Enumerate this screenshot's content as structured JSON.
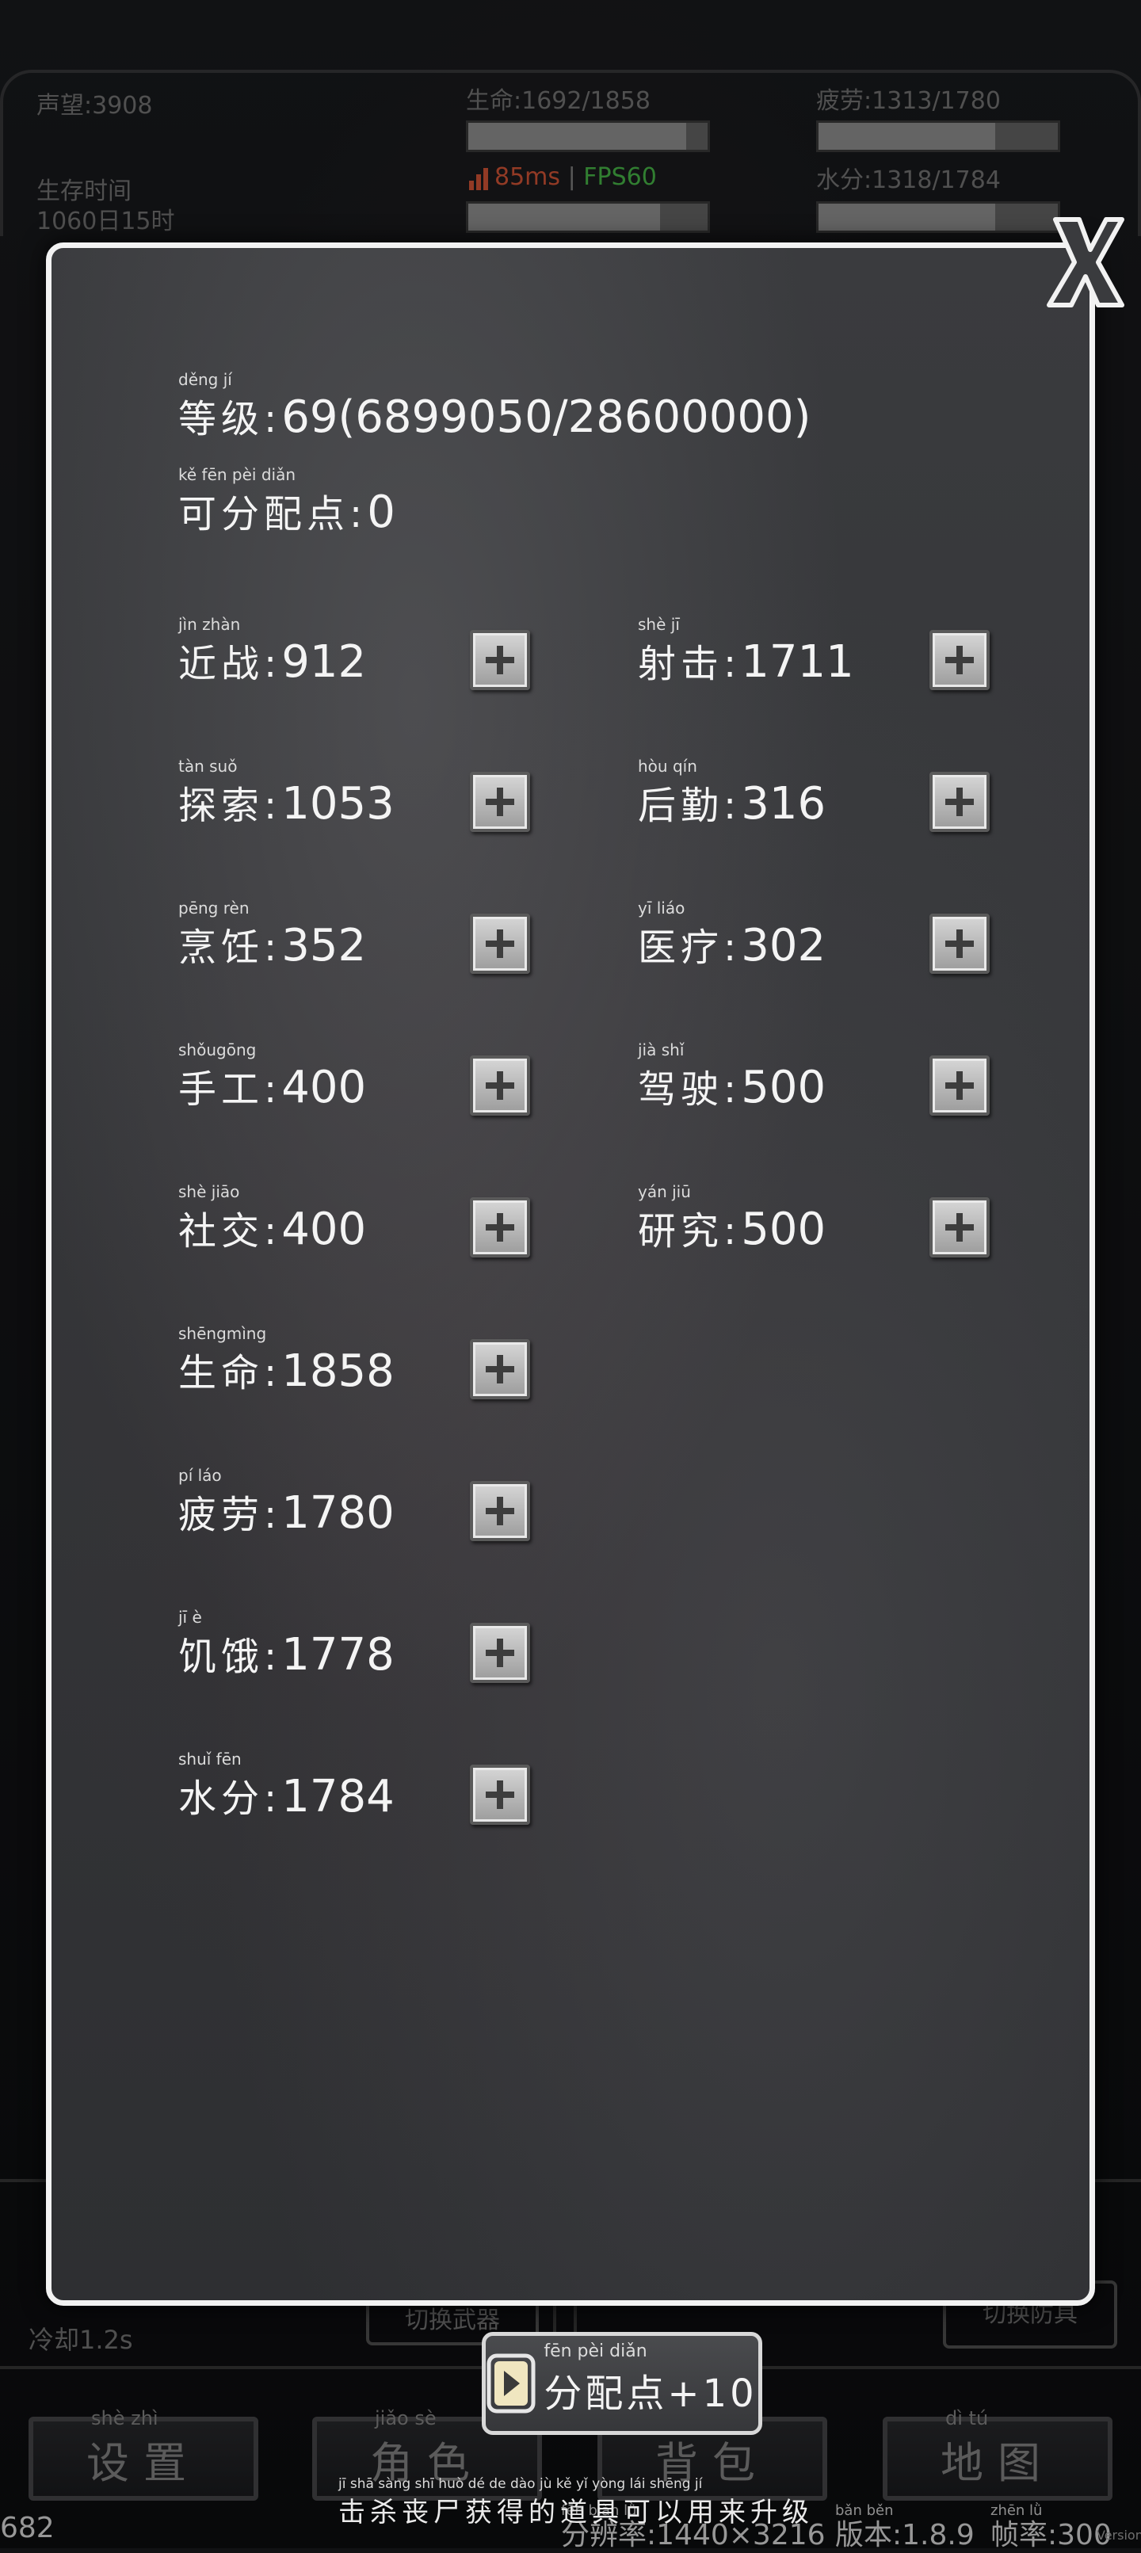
{
  "hud": {
    "reputation": "声望:3908",
    "survival_time_label": "生存时间",
    "survival_time_value": "1060日15时",
    "hp": "生命:1692/1858",
    "fatigue": "疲劳:1313/1780",
    "water": "水分:1318/1784",
    "ping": "85ms",
    "fps": "FPS60",
    "cooldown": "冷却1.2s",
    "switch_weapon": "切换武器",
    "switch_armor": "切换防具"
  },
  "modal": {
    "level_label": "等级:",
    "level_pinyin": "děng  jí",
    "level_value": "69(6899050/28600000)",
    "points_label": "可分配点:",
    "points_pinyin": "kě  fēn  pèi  diǎn",
    "points_value": "0",
    "stats_left": [
      {
        "label": "近战:",
        "pinyin": "jìn  zhàn",
        "value": "912"
      },
      {
        "label": "探索:",
        "pinyin": "tàn  suǒ",
        "value": "1053"
      },
      {
        "label": "烹饪:",
        "pinyin": "pēng  rèn",
        "value": "352"
      },
      {
        "label": "手工:",
        "pinyin": "shǒugōng",
        "value": "400"
      },
      {
        "label": "社交:",
        "pinyin": "shè  jiāo",
        "value": "400"
      },
      {
        "label": "生命:",
        "pinyin": "shēngmìng",
        "value": "1858"
      },
      {
        "label": "疲劳:",
        "pinyin": "pí  láo",
        "value": "1780"
      },
      {
        "label": "饥饿:",
        "pinyin": "jī  è",
        "value": "1778"
      },
      {
        "label": "水分:",
        "pinyin": "shuǐ  fēn",
        "value": "1784"
      }
    ],
    "stats_right": [
      {
        "label": "射击:",
        "pinyin": "shè  jī",
        "value": "1711"
      },
      {
        "label": "后勤:",
        "pinyin": "hòu  qín",
        "value": "316"
      },
      {
        "label": "医疗:",
        "pinyin": "yī  liáo",
        "value": "302"
      },
      {
        "label": "驾驶:",
        "pinyin": "jià  shǐ",
        "value": "500"
      },
      {
        "label": "研究:",
        "pinyin": "yán  jiū",
        "value": "500"
      }
    ],
    "ad_button_label": "分配点+10",
    "ad_button_pinyin": "fēn  pèi  diǎn",
    "tip": "击杀丧尸获得的道具可以用来升级",
    "tip_pinyin": "jī  shā sàng shī huò dé  de  dào  jù  kě  yǐ  yòng lái shēng jí"
  },
  "bottom_nav": [
    {
      "label": "设置",
      "pinyin": "shè  zhì"
    },
    {
      "label": "角色",
      "pinyin": "jiǎo  sè"
    },
    {
      "label": "背包",
      "pinyin": "bèi  bāo"
    },
    {
      "label": "地图",
      "pinyin": "dì  tú"
    }
  ],
  "footer": {
    "left": "682",
    "resolution": "分辨率:1440×3216",
    "resolution_pinyin": "fēn biàn  lǜ",
    "version": "版本:1.8.9",
    "version_pinyin": "bǎn běn",
    "framerate": "帧率:300",
    "framerate_pinyin": "zhēn  lǜ",
    "corner_tag": "Version"
  },
  "colors": {
    "ping": "#e05a3a",
    "fps": "#4cc24c",
    "modal_border": "#f2f2f2"
  }
}
